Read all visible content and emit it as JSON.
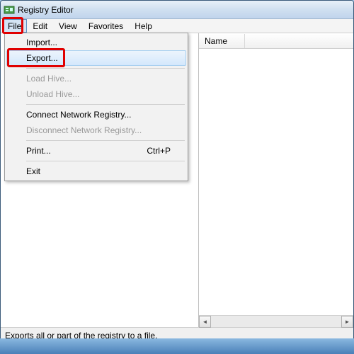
{
  "window": {
    "title": "Registry Editor"
  },
  "menubar": {
    "items": [
      "File",
      "Edit",
      "View",
      "Favorites",
      "Help"
    ],
    "active_index": 0
  },
  "file_menu": {
    "items": [
      {
        "label": "Import...",
        "enabled": true,
        "shortcut": ""
      },
      {
        "label": "Export...",
        "enabled": true,
        "shortcut": "",
        "highlighted": true
      },
      {
        "separator": true
      },
      {
        "label": "Load Hive...",
        "enabled": false,
        "shortcut": ""
      },
      {
        "label": "Unload Hive...",
        "enabled": false,
        "shortcut": ""
      },
      {
        "separator": true
      },
      {
        "label": "Connect Network Registry...",
        "enabled": true,
        "shortcut": ""
      },
      {
        "label": "Disconnect Network Registry...",
        "enabled": false,
        "shortcut": ""
      },
      {
        "separator": true
      },
      {
        "label": "Print...",
        "enabled": true,
        "shortcut": "Ctrl+P"
      },
      {
        "separator": true
      },
      {
        "label": "Exit",
        "enabled": true,
        "shortcut": ""
      }
    ]
  },
  "list_pane": {
    "columns": [
      "Name"
    ]
  },
  "statusbar": {
    "text": "Exports all or part of the registry to a file."
  },
  "annotations": {
    "file_menu_box": true,
    "export_box": true
  }
}
